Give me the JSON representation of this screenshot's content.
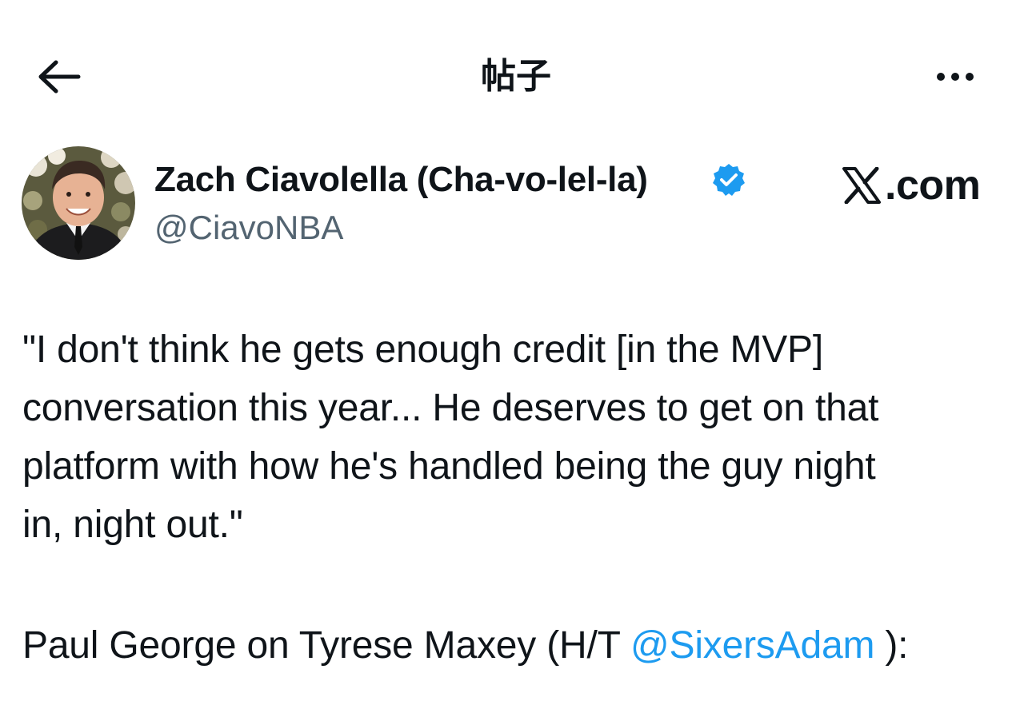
{
  "header": {
    "title": "帖子",
    "back_icon": "arrow-left-icon",
    "more_icon": "more-horizontal-icon"
  },
  "author": {
    "display_name": "Zach Ciavolella (Cha-vo-lel-la)",
    "handle": "@CiavoNBA",
    "verified": true,
    "verified_color": "#1d9bf0"
  },
  "watermark": {
    "text": ".com",
    "icon": "x-logo-icon"
  },
  "tweet": {
    "lines": [
      "\"I don't think he gets enough credit [in the MVP]",
      "conversation this year... He deserves to get on that",
      "platform with how he's handled being the guy night",
      "in, night out.\""
    ],
    "credit_prefix": "Paul George on Tyrese Maxey (H/T ",
    "mention": "@SixersAdam",
    "credit_suffix": " ):"
  },
  "colors": {
    "text": "#0f1419",
    "secondary": "#536471",
    "link": "#1d9bf0"
  }
}
